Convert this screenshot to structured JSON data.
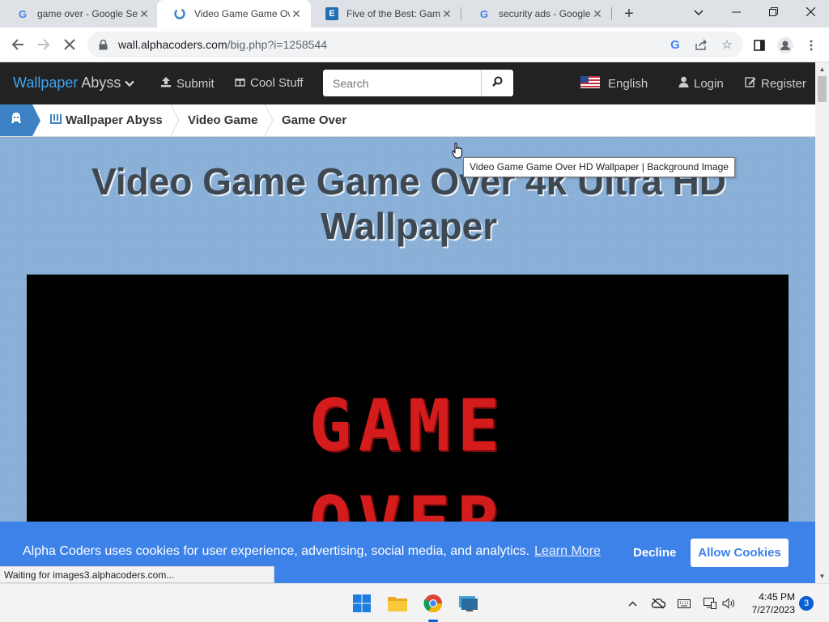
{
  "browser": {
    "tabs": [
      {
        "title": "game over - Google Se",
        "favicon": "google-g-icon",
        "active": false
      },
      {
        "title": "Video Game Game Ove",
        "favicon": "alphacoders-icon",
        "active": true
      },
      {
        "title": "Five of the Best: Game",
        "favicon": "e-site-icon",
        "active": false
      },
      {
        "title": "security ads - Google S",
        "favicon": "google-g-icon",
        "active": false
      }
    ],
    "url_host": "wall.alphacoders.com",
    "url_path": "/big.php?i=1258544",
    "status_text": "Waiting for images3.alphacoders.com..."
  },
  "site": {
    "brand_primary": "Wallpaper",
    "brand_secondary": "Abyss",
    "nav": {
      "submit": "Submit",
      "cool_stuff": "Cool Stuff",
      "language": "English",
      "login": "Login",
      "register": "Register"
    },
    "search_placeholder": "Search",
    "breadcrumbs": [
      "Wallpaper Abyss",
      "Video Game",
      "Game Over"
    ]
  },
  "page": {
    "title": "Video Game Game Over 4k Ultra HD Wallpaper",
    "tooltip": "Video Game Game Over HD Wallpaper | Background Image",
    "wallpaper_line1": "GAME",
    "wallpaper_line2": "OVER"
  },
  "cookie": {
    "message": "Alpha Coders uses cookies for user experience, advertising, social media, and analytics.",
    "learn_more": "Learn More",
    "decline": "Decline",
    "allow": "Allow Cookies"
  },
  "taskbar": {
    "time": "4:45 PM",
    "date": "7/27/2023",
    "notification_count": "3"
  },
  "colors": {
    "accent_blue": "#3d82e8",
    "nav_bg": "#222222",
    "page_bg": "#8ab0d8",
    "game_over_red": "#d41c1c"
  }
}
